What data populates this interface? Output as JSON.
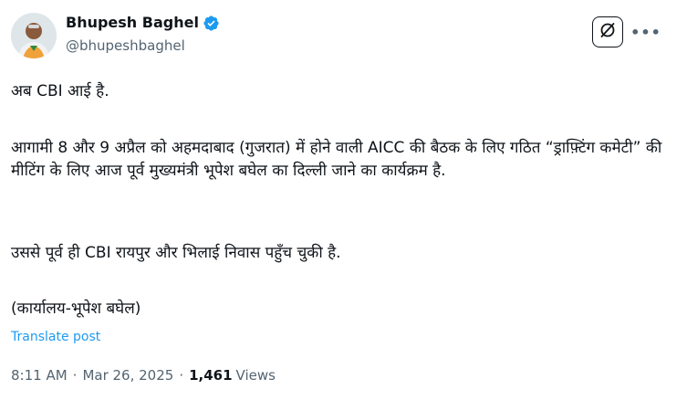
{
  "author": {
    "name": "Bhupesh Baghel",
    "handle": "@bhupeshbaghel",
    "verified": true,
    "verified_color": "#1d9bf0"
  },
  "actions": {
    "grok_icon": "grok-icon",
    "more_label": "•••"
  },
  "post": {
    "paragraphs": [
      "अब CBI आई है.",
      "आगामी 8 और 9 अप्रैल को अहमदाबाद (गुजरात) में होने वाली AICC की बैठक के लिए गठित “ड्राफ़्टिंग कमेटी” की मीटिंग के लिए आज पूर्व मुख्यमंत्री भूपेश बघेल का दिल्ली जाने का कार्यक्रम है.",
      "उससे पूर्व ही CBI रायपुर और भिलाई निवास पहुँच चुकी है.",
      "(कार्यालय-भूपेश बघेल)"
    ],
    "translate_label": "Translate post"
  },
  "meta": {
    "time": "8:11 AM",
    "date": "Mar 26, 2025",
    "separator": "·",
    "views_count": "1,461",
    "views_label": "Views"
  },
  "colors": {
    "text": "#0f1419",
    "secondary": "#536471",
    "link": "#1d9bf0"
  }
}
